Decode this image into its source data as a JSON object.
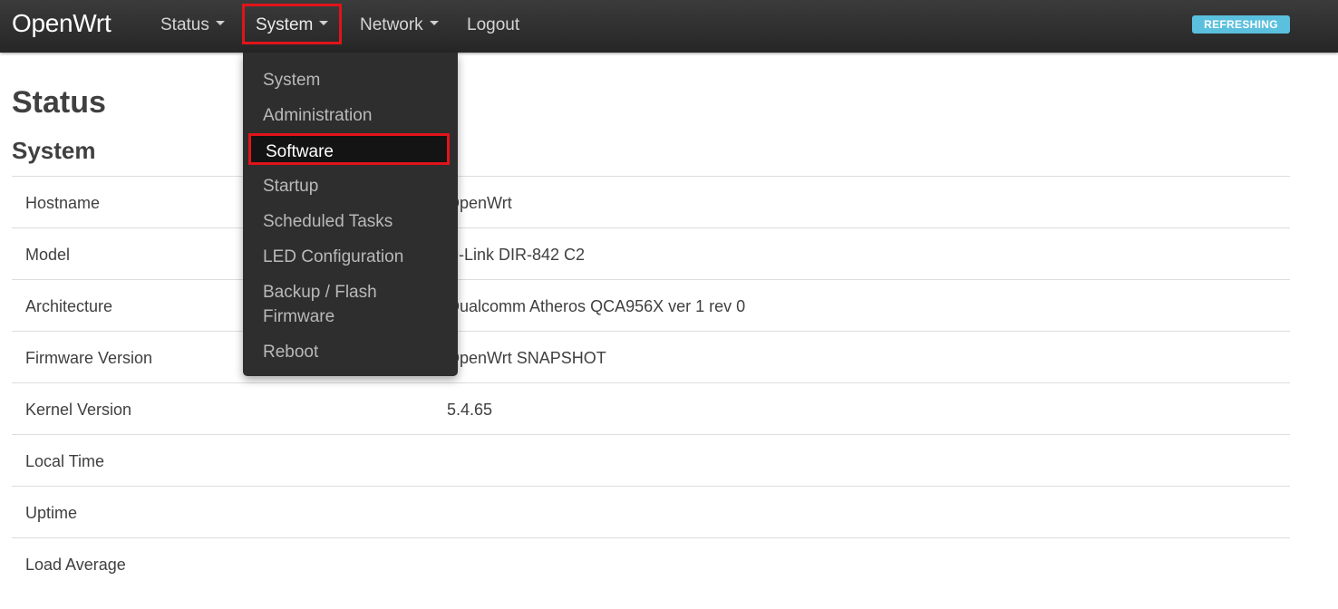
{
  "app": {
    "brand": "OpenWrt",
    "status_badge": "REFRESHING",
    "badge_color": "#5bc0de",
    "highlight_color": "#e1141b"
  },
  "nav": {
    "status": "Status",
    "system": "System",
    "network": "Network",
    "logout": "Logout"
  },
  "system_menu": [
    "System",
    "Administration",
    "Software",
    "Startup",
    "Scheduled Tasks",
    "LED Configuration",
    "Backup / Flash Firmware",
    "Reboot"
  ],
  "page": {
    "title": "Status",
    "section": "System"
  },
  "system_info": [
    {
      "label": "Hostname",
      "value": "OpenWrt"
    },
    {
      "label": "Model",
      "value": "D-Link DIR-842 C2"
    },
    {
      "label": "Architecture",
      "value": "Qualcomm Atheros QCA956X ver 1 rev 0"
    },
    {
      "label": "Firmware Version",
      "value": "OpenWrt SNAPSHOT"
    },
    {
      "label": "Kernel Version",
      "value": "5.4.65"
    },
    {
      "label": "Local Time",
      "value": ""
    },
    {
      "label": "Uptime",
      "value": ""
    },
    {
      "label": "Load Average",
      "value": ""
    }
  ]
}
